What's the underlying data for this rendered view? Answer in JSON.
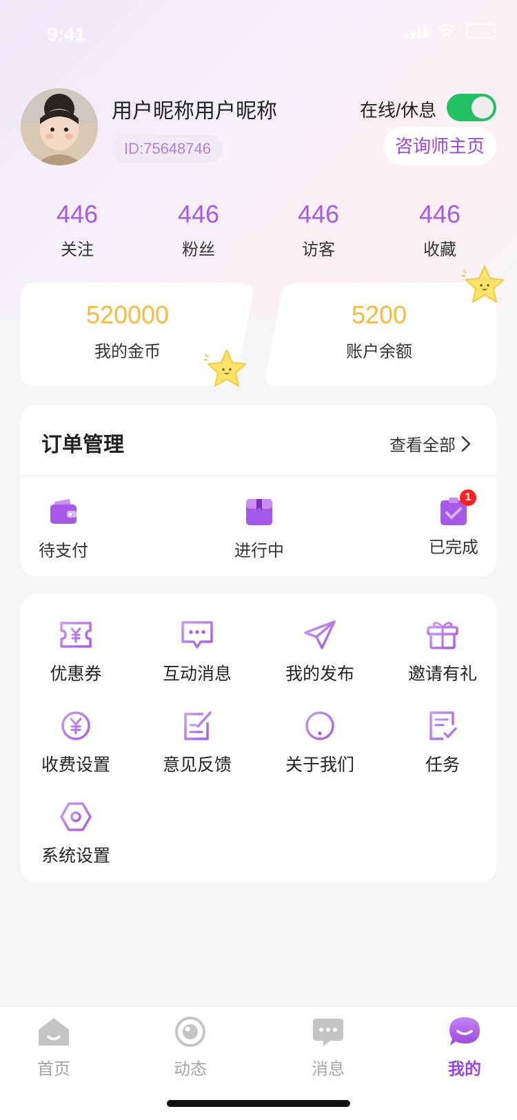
{
  "status_bar": {
    "time": "9:41"
  },
  "profile": {
    "nickname": "用户昵称用户昵称",
    "id_text": "ID:75648746",
    "status_label": "在线/休息",
    "online": true,
    "counselor_button": "咨询师主页"
  },
  "stats": [
    {
      "value": "446",
      "label": "关注"
    },
    {
      "value": "446",
      "label": "粉丝"
    },
    {
      "value": "446",
      "label": "访客"
    },
    {
      "value": "446",
      "label": "收藏"
    }
  ],
  "wallet": {
    "coins": {
      "value": "520000",
      "label": "我的金币"
    },
    "balance": {
      "value": "5200",
      "label": "账户余额"
    }
  },
  "orders": {
    "title": "订单管理",
    "view_all": "查看全部",
    "items": [
      {
        "label": "待支付",
        "icon": "wallet-icon"
      },
      {
        "label": "进行中",
        "icon": "box-icon"
      },
      {
        "label": "已完成",
        "icon": "clipboard-check-icon",
        "badge": "1"
      }
    ]
  },
  "services": [
    {
      "label": "优惠券",
      "icon": "coupon-icon"
    },
    {
      "label": "互动消息",
      "icon": "message-icon"
    },
    {
      "label": "我的发布",
      "icon": "paper-plane-icon"
    },
    {
      "label": "邀请有礼",
      "icon": "gift-icon"
    },
    {
      "label": "收费设置",
      "icon": "yuan-coin-icon"
    },
    {
      "label": "意见反馈",
      "icon": "edit-icon"
    },
    {
      "label": "关于我们",
      "icon": "info-icon"
    },
    {
      "label": "任务",
      "icon": "task-icon"
    },
    {
      "label": "系统设置",
      "icon": "settings-icon"
    }
  ],
  "tabbar": [
    {
      "label": "首页",
      "icon": "home-icon",
      "active": false
    },
    {
      "label": "动态",
      "icon": "camera-icon",
      "active": false
    },
    {
      "label": "消息",
      "icon": "chat-icon",
      "active": false
    },
    {
      "label": "我的",
      "icon": "smile-chat-icon",
      "active": true
    }
  ],
  "colors": {
    "accent": "#a658e8",
    "gold": "#f9b93a",
    "toggle_on": "#21c161",
    "badge": "#ff2020",
    "inactive_tab": "#bdbdbd"
  }
}
